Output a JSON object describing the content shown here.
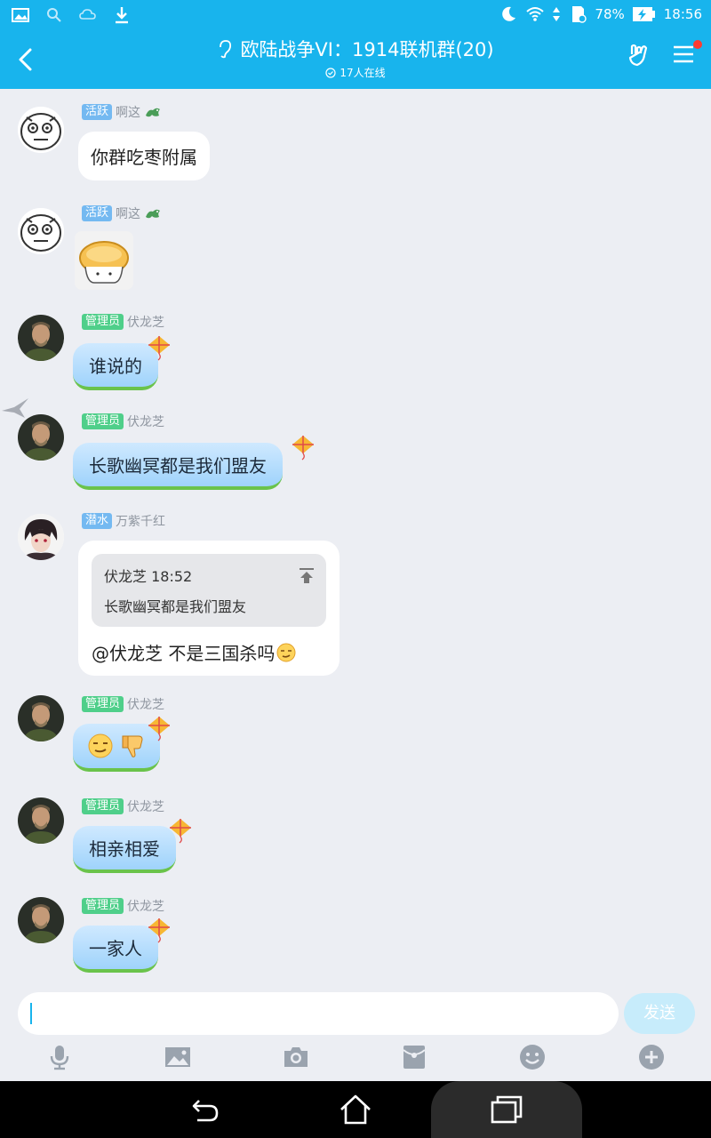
{
  "status_bar": {
    "battery": "78%",
    "time": "18:56"
  },
  "header": {
    "title": "欧陆战争VI：1914联机群(20)",
    "online": "17人在线"
  },
  "messages": [
    {
      "badge": "活跃",
      "name": "啊这",
      "text": "你群吃枣附属"
    },
    {
      "badge": "活跃",
      "name": "啊这",
      "sticker": "bun-sticker"
    },
    {
      "badge": "管理员",
      "name": "伏龙芝",
      "text": "谁说的"
    },
    {
      "badge": "管理员",
      "name": "伏龙芝",
      "text": "长歌幽冥都是我们盟友"
    },
    {
      "badge": "潜水",
      "name": "万紫千红",
      "quote_author": "伏龙芝 18:52",
      "quote_text": "长歌幽冥都是我们盟友",
      "text": "@伏龙芝 不是三国杀吗"
    },
    {
      "badge": "管理员",
      "name": "伏龙芝",
      "emojis": [
        "smirk-emoji",
        "thumbs-down-emoji"
      ]
    },
    {
      "badge": "管理员",
      "name": "伏龙芝",
      "text": "相亲相爱"
    },
    {
      "badge": "管理员",
      "name": "伏龙芝",
      "text": "一家人"
    }
  ],
  "input": {
    "send_label": "发送"
  },
  "colors": {
    "accent": "#18b4ed",
    "badge_blue": "#74b9f1",
    "badge_green": "#4fcf8a"
  }
}
